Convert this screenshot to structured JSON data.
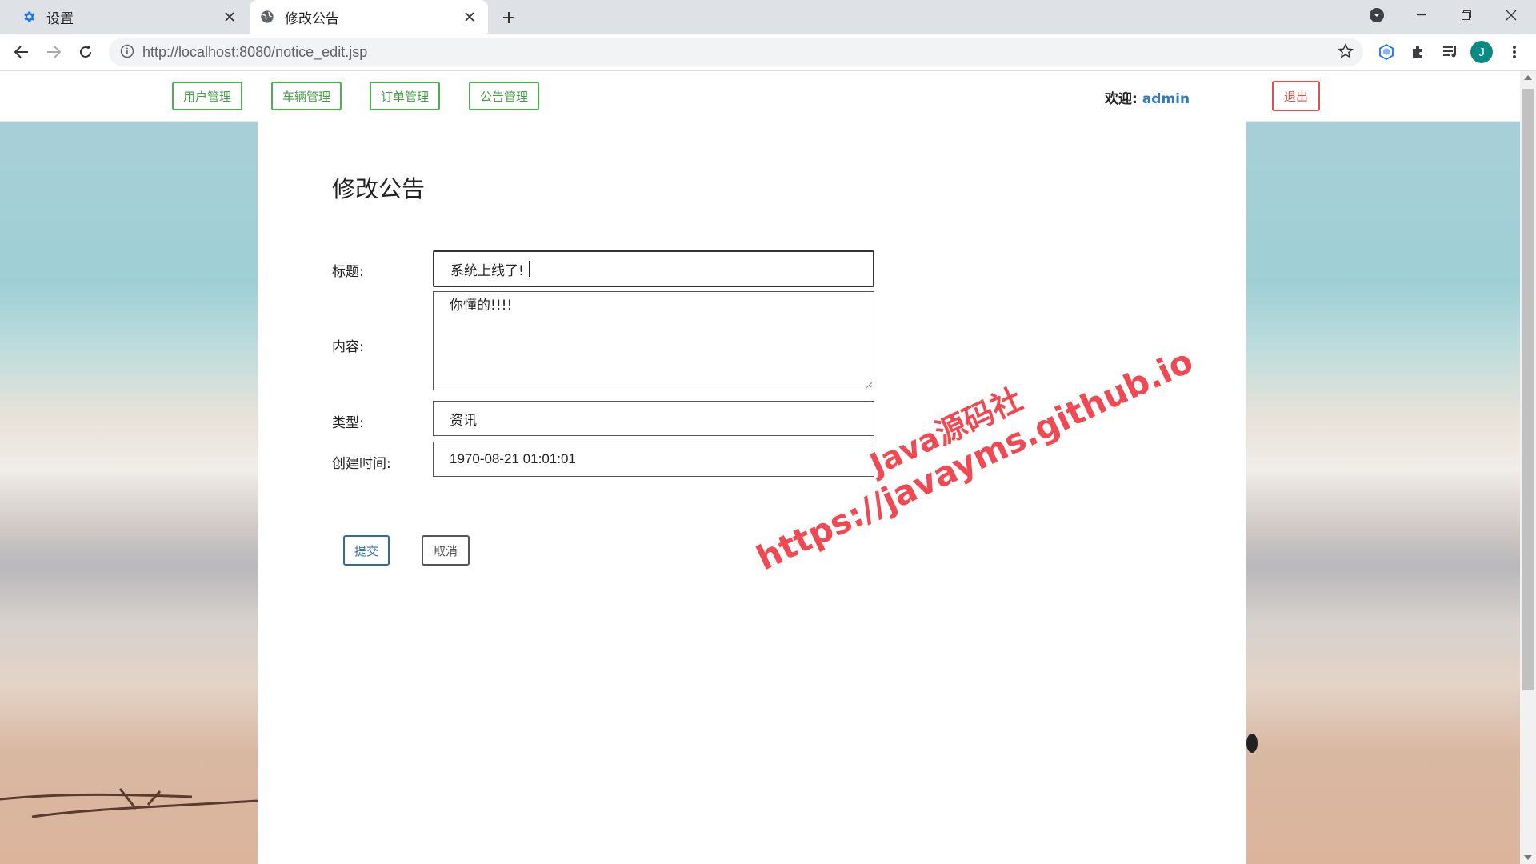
{
  "browser": {
    "tabs": [
      {
        "label": "设置",
        "icon": "gear-icon"
      },
      {
        "label": "修改公告",
        "icon": "globe-icon"
      }
    ],
    "url_host": "http://localhost",
    "url_path": ":8080/notice_edit.jsp",
    "avatar_letter": "J"
  },
  "nav": {
    "items": [
      "用户管理",
      "车辆管理",
      "订单管理",
      "公告管理"
    ],
    "welcome_label": "欢迎:",
    "username": "admin",
    "logout_label": "退出"
  },
  "form": {
    "heading": "修改公告",
    "title_label": "标题:",
    "title_value": "系统上线了!",
    "content_label": "内容:",
    "content_value": "你懂的!!!!",
    "type_label": "类型:",
    "type_value": "资讯",
    "created_label": "创建时间:",
    "created_value": "1970-08-21 01:01:01",
    "submit_label": "提交",
    "cancel_label": "取消"
  },
  "watermark": {
    "line1": "Java源码社",
    "line2": "https://javayms.github.io"
  },
  "colors": {
    "nav_button": "#4cae4c",
    "logout": "#d9534f",
    "submit": "#2e6da4",
    "username": "#337ab7",
    "watermark": "#ee3b45"
  }
}
